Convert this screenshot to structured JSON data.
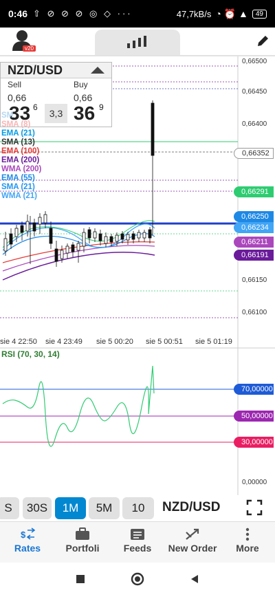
{
  "status_bar": {
    "time": "0:46",
    "icons": "⇧ ⊘ ⊘ ⊘ ◎ ◇ ···",
    "speed": "47,7kB/s",
    "battery": "49"
  },
  "user": {
    "badge": "v20"
  },
  "instrument": {
    "pair": "NZD/USD",
    "sell": {
      "label": "Sell",
      "small": "0,66",
      "big": "33",
      "sup": "6"
    },
    "buy": {
      "label": "Buy",
      "small": "0,66",
      "big": "36",
      "sup": "9"
    },
    "spread": "3,3"
  },
  "indicators": [
    {
      "label": "SMA (8)",
      "color": "#f8b5b5"
    },
    {
      "label": "SMA (13)",
      "color": "#333333"
    },
    {
      "label": "EMA (100)",
      "color": "#e53935"
    },
    {
      "label": "EMA (200)",
      "color": "#6a1b9a"
    },
    {
      "label": "WMA (200)",
      "color": "#ab47bc"
    },
    {
      "label": "EMA (55)",
      "color": "#1e88e5"
    },
    {
      "label": "SMA (21)",
      "color": "#2196f3"
    },
    {
      "label": "WMA (21)",
      "color": "#42a5f5"
    }
  ],
  "indicator_extra": {
    "ema21": "EMA (21)",
    "ema21_color": "#039be5",
    "sm_partial": "SM"
  },
  "price_axis": [
    "0,66500",
    "0,66450",
    "0,66400",
    "0,66150",
    "0,66100"
  ],
  "price_tags": [
    {
      "value": "0,66352",
      "color": "#ffffff",
      "plain": true
    },
    {
      "value": "0,66291",
      "color": "#2ecc71"
    },
    {
      "value": "0,66250",
      "color": "#1e88e5"
    },
    {
      "value": "0,66234",
      "color": "#42a5f5"
    },
    {
      "value": "0,66211",
      "color": "#ab47bc"
    },
    {
      "value": "0,66191",
      "color": "#6a1b9a"
    }
  ],
  "time_axis": [
    "sie 4 22:50",
    "sie 4 23:49",
    "sie 5 00:20",
    "sie 5 00:51",
    "sie 5 01:19"
  ],
  "rsi": {
    "title": "RSI (70, 30, 14)",
    "levels": [
      {
        "value": "70,00000",
        "color": "#1e5bd6"
      },
      {
        "value": "50,00000",
        "color": "#9c27b0"
      },
      {
        "value": "30,00000",
        "color": "#e91e63"
      }
    ],
    "bottom": "0,00000"
  },
  "timeframes": [
    "S",
    "30S",
    "1M",
    "5M",
    "10"
  ],
  "active_timeframe": "1M",
  "nav": [
    {
      "label": "Rates",
      "icon": "rates-icon",
      "active": true
    },
    {
      "label": "Portfoli",
      "icon": "briefcase-icon",
      "active": false
    },
    {
      "label": "Feeds",
      "icon": "feeds-icon",
      "active": false
    },
    {
      "label": "New Order",
      "icon": "new-order-icon",
      "active": false
    },
    {
      "label": "More",
      "icon": "more-icon",
      "active": false
    }
  ]
}
